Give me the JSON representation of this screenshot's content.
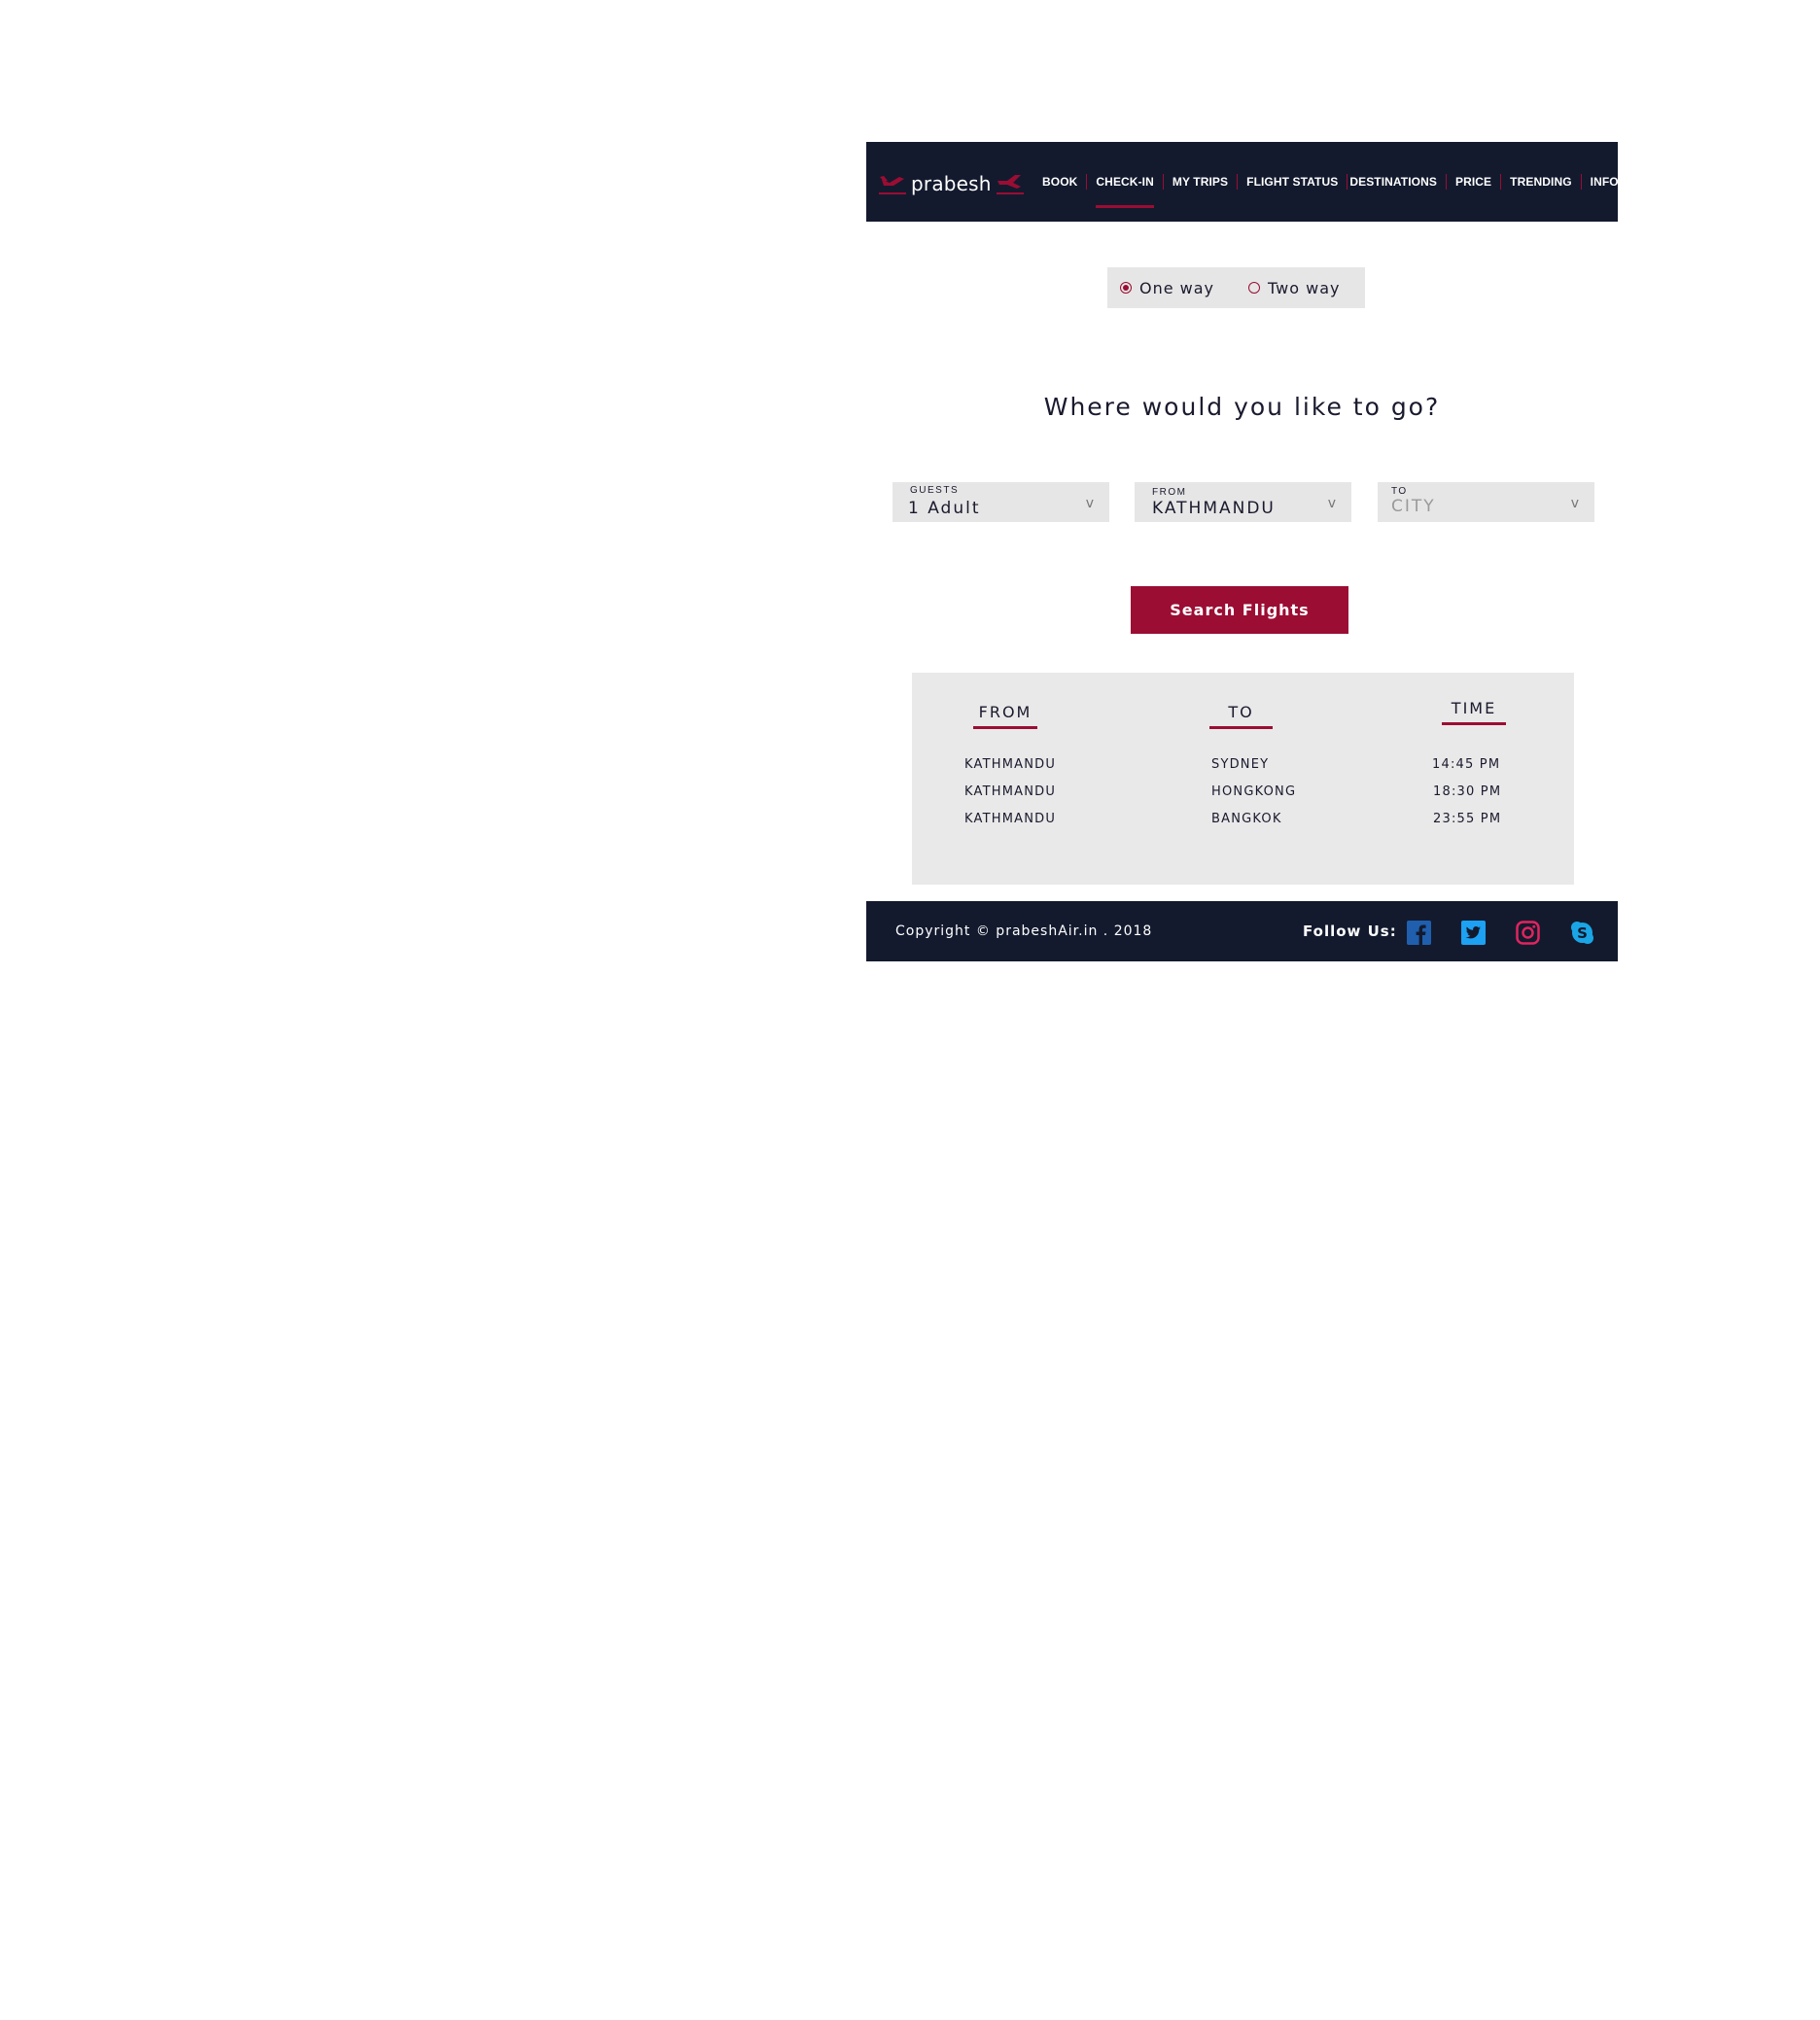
{
  "brand": {
    "name": "prabesh",
    "accent": "#9b0d33",
    "navy": "#131a2e"
  },
  "nav": {
    "items": [
      {
        "label": "BOOK"
      },
      {
        "label": "CHECK-IN",
        "active": true
      },
      {
        "label": "MY TRIPS"
      },
      {
        "label": "FLIGHT STATUS"
      },
      {
        "label": "DESTINATIONS"
      },
      {
        "label": "PRICE"
      },
      {
        "label": "TRENDING"
      },
      {
        "label": "INFO"
      }
    ]
  },
  "trip_type": {
    "options": [
      {
        "label": "One way",
        "checked": true
      },
      {
        "label": "Two way",
        "checked": false
      }
    ]
  },
  "headline": "Where would you like to go?",
  "selects": {
    "guests": {
      "label": "GUESTS",
      "value": "1 Adult",
      "icon": "chevron-down-icon"
    },
    "from": {
      "label": "FROM",
      "value": "KATHMANDU",
      "icon": "chevron-down-icon"
    },
    "to": {
      "label": "TO",
      "placeholder": "CITY",
      "icon": "chevron-down-icon"
    }
  },
  "search_button": "Search Flights",
  "schedule": {
    "headers": {
      "from": "FROM",
      "to": "TO",
      "time": "TIME"
    },
    "rows": [
      {
        "from": "KATHMANDU",
        "to": "SYDNEY",
        "time": "14:45 PM"
      },
      {
        "from": "KATHMANDU",
        "to": "HONGKONG",
        "time": "18:30 PM"
      },
      {
        "from": "KATHMANDU",
        "to": "BANGKOK",
        "time": "23:55 PM"
      }
    ]
  },
  "footer": {
    "copyright": "Copyright © prabeshAir.in . 2018",
    "follow_label": "Follow Us:",
    "social": [
      {
        "name": "facebook-icon",
        "color": "#1f5fae"
      },
      {
        "name": "twitter-icon",
        "color": "#1da1f2"
      },
      {
        "name": "instagram-icon",
        "color": "#e0245e"
      },
      {
        "name": "skype-icon",
        "color": "#1aa6e6"
      }
    ]
  }
}
